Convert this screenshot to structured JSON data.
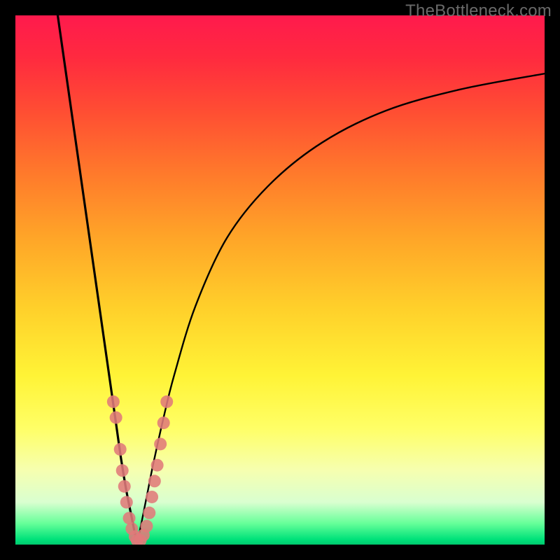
{
  "watermark": "TheBottleneck.com",
  "chart_data": {
    "type": "line",
    "title": "",
    "xlabel": "",
    "ylabel": "",
    "xlim": [
      0,
      100
    ],
    "ylim": [
      0,
      100
    ],
    "grid": false,
    "legend": false,
    "series": [
      {
        "name": "left-branch",
        "color": "#000000",
        "x": [
          8,
          10,
          12,
          14,
          16,
          18,
          19,
          20,
          21,
          22,
          23
        ],
        "y": [
          100,
          86,
          72,
          58,
          44,
          30,
          23,
          16,
          10,
          5,
          0
        ]
      },
      {
        "name": "right-branch",
        "color": "#000000",
        "x": [
          23,
          24,
          25,
          26,
          28,
          30,
          34,
          40,
          48,
          58,
          70,
          84,
          100
        ],
        "y": [
          0,
          5,
          10,
          15,
          24,
          32,
          45,
          58,
          68,
          76,
          82,
          86,
          89
        ]
      }
    ],
    "scatter": {
      "name": "highlight-points",
      "color": "#e07a7a",
      "radius": 9,
      "points": [
        {
          "x": 18.5,
          "y": 27
        },
        {
          "x": 19.0,
          "y": 24
        },
        {
          "x": 19.8,
          "y": 18
        },
        {
          "x": 20.2,
          "y": 14
        },
        {
          "x": 20.6,
          "y": 11
        },
        {
          "x": 21.0,
          "y": 8
        },
        {
          "x": 21.5,
          "y": 5
        },
        {
          "x": 22.0,
          "y": 3
        },
        {
          "x": 22.6,
          "y": 1.5
        },
        {
          "x": 23.0,
          "y": 0.8
        },
        {
          "x": 23.6,
          "y": 0.8
        },
        {
          "x": 24.2,
          "y": 1.8
        },
        {
          "x": 24.8,
          "y": 3.5
        },
        {
          "x": 25.3,
          "y": 6
        },
        {
          "x": 25.8,
          "y": 9
        },
        {
          "x": 26.3,
          "y": 12
        },
        {
          "x": 26.8,
          "y": 15
        },
        {
          "x": 27.4,
          "y": 19
        },
        {
          "x": 28.0,
          "y": 23
        },
        {
          "x": 28.6,
          "y": 27
        }
      ]
    }
  }
}
